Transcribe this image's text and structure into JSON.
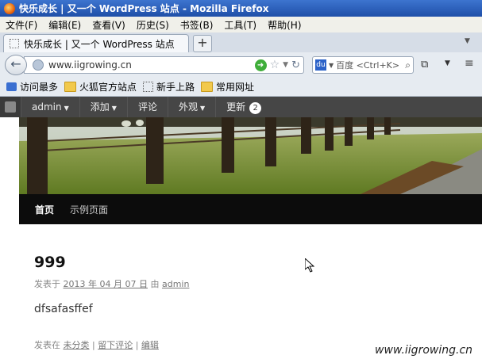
{
  "window": {
    "title": "快乐成长 | 又一个 WordPress 站点 - Mozilla Firefox"
  },
  "menu": [
    "文件(F)",
    "编辑(E)",
    "查看(V)",
    "历史(S)",
    "书签(B)",
    "工具(T)",
    "帮助(H)"
  ],
  "tab": {
    "title": "快乐成长 | 又一个 WordPress 站点",
    "new_tab": "+"
  },
  "nav": {
    "url": "www.iigrowing.cn",
    "search_placeholder": "百度 <Ctrl+K>"
  },
  "bookmarks": [
    "访问最多",
    "火狐官方站点",
    "新手上路",
    "常用网址"
  ],
  "adminbar": {
    "user": "admin",
    "add": "添加",
    "comments": "评论",
    "appearance": "外观",
    "updates": "更新",
    "update_count": "2"
  },
  "site_nav": [
    "首页",
    "示例页面"
  ],
  "post": {
    "title": "999",
    "meta_prefix": "发表于 ",
    "date": "2013 年 04 月 07 日",
    "meta_by": " 由 ",
    "author": "admin",
    "body": "dfsafasffef",
    "footer_prefix": "发表在 ",
    "category": "未分类",
    "sep": " | ",
    "comment": "留下评论",
    "edit": "编辑"
  },
  "watermark": "www.iigrowing.cn",
  "colors": {
    "titlebar": "#2a5fbf",
    "adminbar": "#464646",
    "site_nav": "#0c0c0c"
  }
}
